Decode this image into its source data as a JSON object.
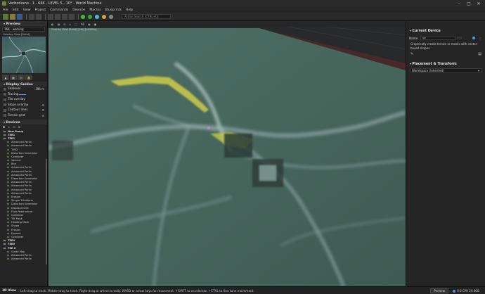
{
  "window": {
    "title": "Verbodrano - 1 - 64K - LEVEL 5 - 10* - World Machine",
    "controls": [
      "–",
      "□",
      "✕"
    ]
  },
  "menu": [
    "File",
    "Edit",
    "View",
    "Project",
    "Commands",
    "Devices",
    "Macros",
    "Blueprints",
    "Help"
  ],
  "toolbar": {
    "search_placeholder": "Action Search (CTRL+Q)"
  },
  "left": {
    "preview": {
      "header": "Preview",
      "preset": "16K - working",
      "overlay_label": "Overlay View [Solid]"
    },
    "guides": {
      "header": "Display Guides",
      "rows": [
        {
          "label": "Sealevel",
          "value": "-396 m"
        },
        {
          "label": "Tracing",
          "value": ""
        },
        {
          "label": "Tile overlay",
          "value": ""
        },
        {
          "label": "Slope overlay",
          "value": ""
        },
        {
          "label": "Contour lines",
          "value": ""
        },
        {
          "label": "Terrain grid",
          "value": ""
        }
      ]
    },
    "devices": {
      "header": "Devices",
      "tree": [
        {
          "label": "New Group",
          "group": true
        },
        {
          "label": "TER1",
          "group": true
        },
        {
          "label": "TER1",
          "group": true
        },
        {
          "label": "Advanced Perlin",
          "group": false
        },
        {
          "label": "Advanced Perlin",
          "group": false
        },
        {
          "label": "TER2",
          "group": false
        },
        {
          "label": "Distortion Generator",
          "group": false
        },
        {
          "label": "Combiner",
          "group": false
        },
        {
          "label": "Voronoi",
          "group": false
        },
        {
          "label": "Blur",
          "group": false
        },
        {
          "label": "Advanced Perlin",
          "group": false
        },
        {
          "label": "Advanced Perlin",
          "group": false
        },
        {
          "label": "Advanced Perlin",
          "group": false
        },
        {
          "label": "Distortion Generator",
          "group": false
        },
        {
          "label": "Advanced Perlin",
          "group": false
        },
        {
          "label": "Advanced Perlin",
          "group": false
        },
        {
          "label": "Advanced Perlin",
          "group": false
        },
        {
          "label": "Advanced Perlin",
          "group": false
        },
        {
          "label": "Erosion",
          "group": false
        },
        {
          "label": "Simple Transform",
          "group": false
        },
        {
          "label": "Distortion Generator",
          "group": false
        },
        {
          "label": "Displacement",
          "group": false
        },
        {
          "label": "Flow Restructure",
          "group": false
        },
        {
          "label": "Combiner",
          "group": false
        },
        {
          "label": "Tilt Mask",
          "group": false
        },
        {
          "label": "Heading Mask",
          "group": false
        },
        {
          "label": "Shape",
          "group": false
        },
        {
          "label": "Erosion",
          "group": false
        },
        {
          "label": "Expand",
          "group": false
        },
        {
          "label": "Combiner",
          "group": false
        },
        {
          "label": "TER4",
          "group": true
        },
        {
          "label": "TER5",
          "group": true
        },
        {
          "label": "TER 6",
          "group": true
        },
        {
          "label": "Guide Map",
          "group": false
        },
        {
          "label": "Advanced Perlin",
          "group": false
        },
        {
          "label": "Advanced Perlin",
          "group": false
        }
      ]
    }
  },
  "viewport": {
    "toolbar": [
      "◐",
      "◑",
      "⟲",
      "⌂",
      "⬚",
      "AB",
      "◉",
      "▣"
    ],
    "overlay_label": "Overlay View [Solid] [16k] [40960x]"
  },
  "right": {
    "current_device": {
      "header": "Current Device",
      "name_label": "Name",
      "name_value": "ue",
      "name_hint": "(F2)",
      "description": "Graphically create terrain or masks with vector-based shapes"
    },
    "placement": {
      "header": "Placement & Transform",
      "workspace": "Worldspace (Inherited)"
    }
  },
  "status": {
    "mode": "3D View",
    "message": ": Left-drag to track. Middle-drag to track. Right-drag or wheel to dolly. WASD or arrow keys for movement. +SHIFT to accelerate, +CTRL to fine tune movement.",
    "preview_button": "Preview",
    "resources": "0.0 CPU 24.6GB"
  }
}
